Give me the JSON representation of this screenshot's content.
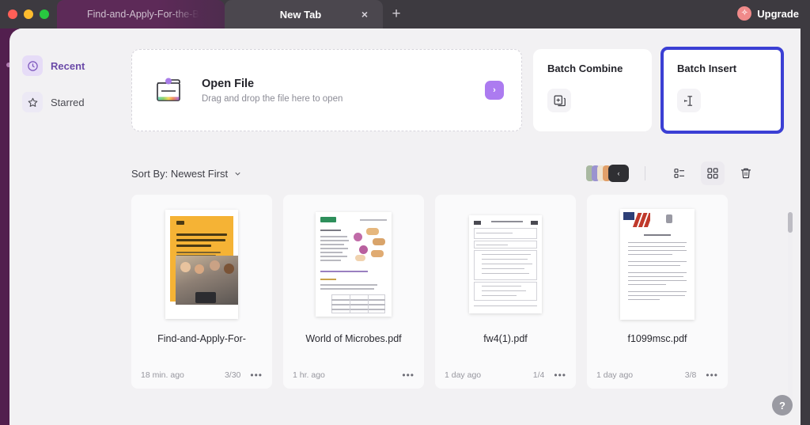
{
  "window": {
    "traffic_lights": [
      "close",
      "minimize",
      "maximize"
    ]
  },
  "tabs": [
    {
      "label": "Find-and-Apply-For-the-B",
      "active": false,
      "closable": false
    },
    {
      "label": "New Tab",
      "active": true,
      "closable": true
    }
  ],
  "new_tab_button": "+",
  "tab_close_glyph": "×",
  "upgrade": {
    "label": "Upgrade",
    "badge_glyph": "✧"
  },
  "sidebar": {
    "items": [
      {
        "label": "Recent",
        "icon": "clock-icon",
        "active": true
      },
      {
        "label": "Starred",
        "icon": "star-icon",
        "active": false
      }
    ]
  },
  "open_file": {
    "title": "Open File",
    "subtitle": "Drag and drop the file here to open",
    "go_glyph": "›",
    "icon": "folder-icon"
  },
  "batch_cards": [
    {
      "title": "Batch Combine",
      "icon": "combine-documents-icon",
      "focused": false
    },
    {
      "title": "Batch Insert",
      "icon": "insert-pages-icon",
      "focused": true
    }
  ],
  "toolbar": {
    "sort_label": "Sort By: Newest First",
    "sort_chevron": "⌄",
    "color_stack_chevron": "‹",
    "list_view_icon": "list-view-icon",
    "grid_view_icon": "grid-view-icon",
    "trash_icon": "trash-icon",
    "active_view": "grid"
  },
  "files": [
    {
      "name": "Find-and-Apply-For-",
      "time": "18 min. ago",
      "pages": "3/30",
      "menu_glyph": "•••",
      "thumb": "brochure-orange"
    },
    {
      "name": "World of Microbes.pdf",
      "time": "1 hr. ago",
      "pages": "",
      "menu_glyph": "•••",
      "thumb": "worksheet-diagram"
    },
    {
      "name": "fw4(1).pdf",
      "time": "1 day ago",
      "pages": "1/4",
      "menu_glyph": "•••",
      "thumb": "tax-form"
    },
    {
      "name": "f1099msc.pdf",
      "time": "1 day ago",
      "pages": "3/8",
      "menu_glyph": "•••",
      "thumb": "gov-letter"
    }
  ],
  "help": {
    "label": "?"
  },
  "colors": {
    "titlebar": "#3d3a40",
    "tab_inactive": "#5d2a58",
    "tab_active": "#4b474e",
    "rail": "#521f4e",
    "surface": "#f2f1f3",
    "accent_purple": "#ac7bf0",
    "focus_blue": "#3b3fd4",
    "upgrade_badge": "#f08a8a"
  }
}
